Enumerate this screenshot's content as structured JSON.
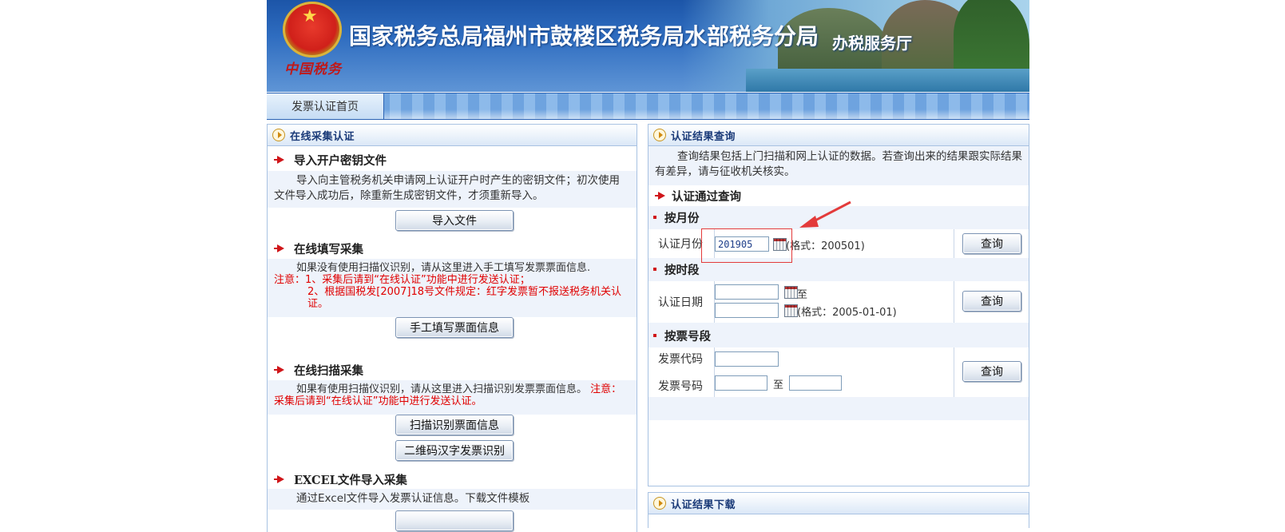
{
  "header": {
    "emblem_text": "中国税务",
    "office_title": "国家税务总局福州市鼓楼区税务局水部税务分局",
    "hall_title": "办税服务厅"
  },
  "nav": {
    "tab_label": "发票认证首页"
  },
  "left_panel": {
    "title": "在线采集认证",
    "sections": {
      "import_key": {
        "heading": "导入开户密钥文件",
        "desc": "导入向主管税务机关申请网上认证开户时产生的密钥文件；初次使用文件导入成功后，除重新生成密钥文件，才须重新导入。",
        "button": "导入文件"
      },
      "manual": {
        "heading": "在线填写采集",
        "desc_normal": "如果没有使用扫描仪识别，请从这里进入手工填写发票票面信息.",
        "desc_red1": "注意：1、采集后请到“在线认证”功能中进行发送认证；",
        "desc_red2": "2、根据国税发[2007]18号文件规定：红字发票暂不报送税务机关认证。",
        "button": "手工填写票面信息"
      },
      "scan": {
        "heading": "在线扫描采集",
        "desc_normal": "如果有使用扫描仪识别，请从这里进入扫描识别发票票面信息。",
        "desc_red": "注意：采集后请到“在线认证”功能中进行发送认证。",
        "button1": "扫描识别票面信息",
        "button2": "二维码汉字发票识别"
      },
      "excel": {
        "heading": "EXCEL文件导入采集",
        "desc": "通过Excel文件导入发票认证信息。下载文件模板"
      }
    }
  },
  "right_panel": {
    "title": "认证结果查询",
    "intro": "查询结果包括上门扫描和网上认证的数据。若查询出来的结果跟实际结果有差异，请与征收机关核实。",
    "section_heading": "认证通过查询",
    "by_month": {
      "heading": "按月份",
      "label": "认证月份",
      "value": "201905",
      "format_hint": "(格式：200501)",
      "button": "查询"
    },
    "by_period": {
      "heading": "按时段",
      "label": "认证日期",
      "start_value": "",
      "end_value": "",
      "to_text": "至",
      "format_hint": "(格式：2005-01-01)",
      "button": "查询"
    },
    "by_number": {
      "heading": "按票号段",
      "code_label": "发票代码",
      "number_label": "发票号码",
      "code_value": "",
      "number_start": "",
      "number_end": "",
      "to_text": "至",
      "button": "查询"
    }
  },
  "download_panel": {
    "title": "认证结果下载"
  },
  "colors": {
    "header_blue": "#1c55a8",
    "panel_title": "#1a3a78",
    "accent_red": "#d0161a",
    "annotation_red": "#e33b3b",
    "panel_border": "#a8c2e2"
  }
}
